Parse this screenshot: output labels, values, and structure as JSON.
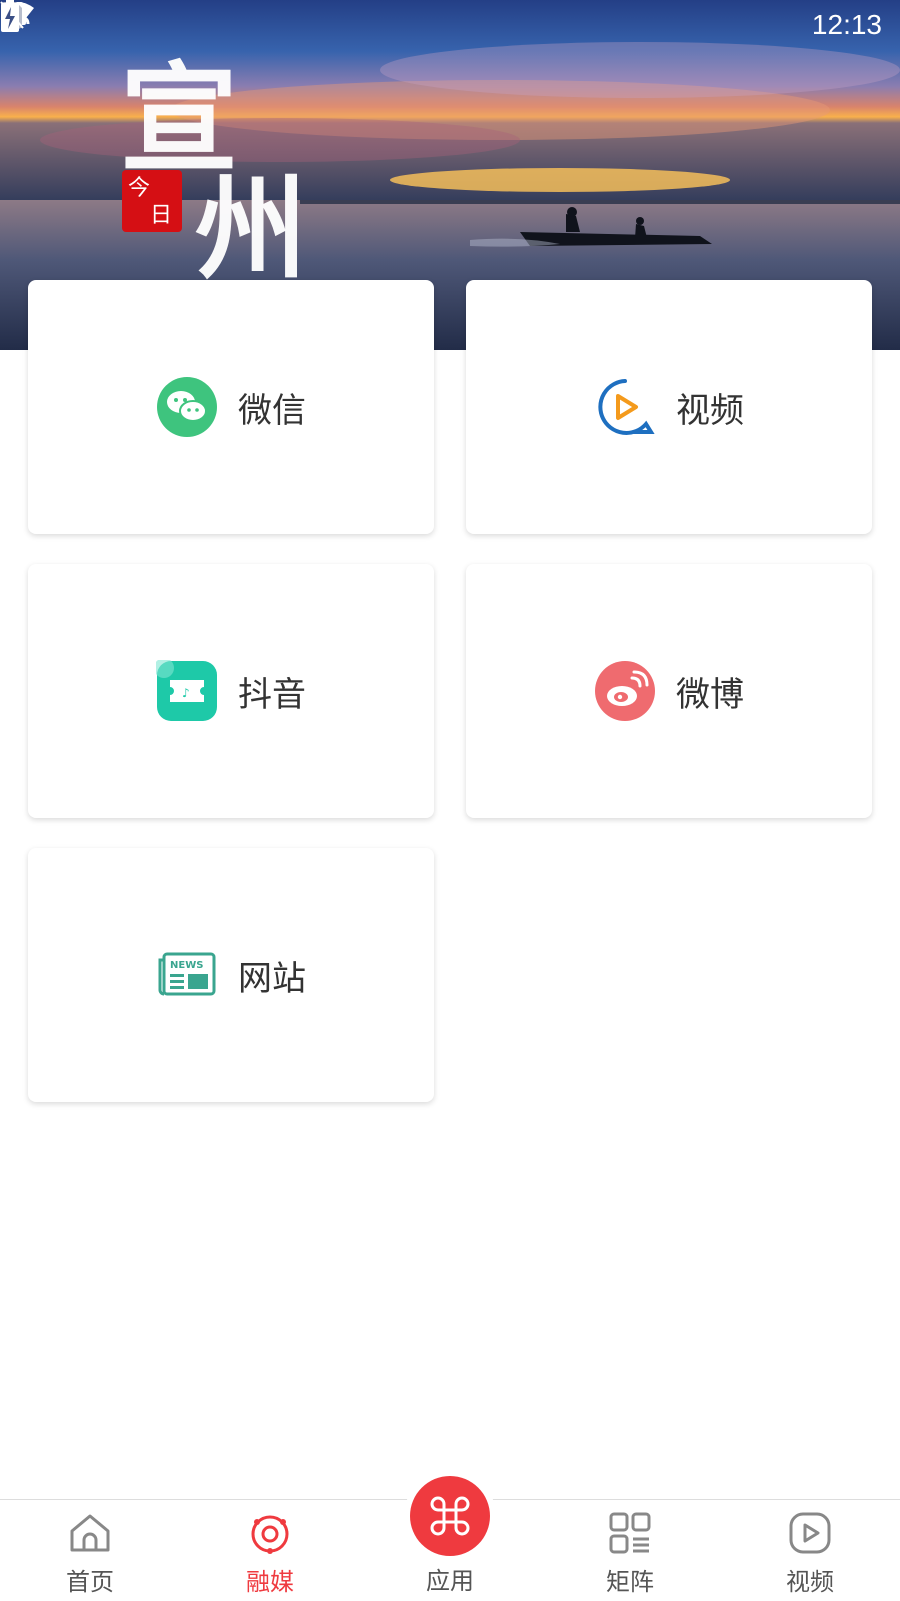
{
  "status_bar": {
    "time": "12:13",
    "icons": [
      "image-icon",
      "bug-icon",
      "text-input-icon",
      "wifi-icon",
      "no-sim-icon",
      "battery-charging-icon"
    ]
  },
  "banner": {
    "logo_text": "宣州",
    "seal_text": "今日"
  },
  "cards": [
    {
      "label": "微信",
      "icon": "wechat-icon",
      "color": "#3ec47e"
    },
    {
      "label": "视频",
      "icon": "video-play-icon",
      "color": "#1e6fc0"
    },
    {
      "label": "抖音",
      "icon": "douyin-icon",
      "color": "#1ec9a8"
    },
    {
      "label": "微博",
      "icon": "weibo-icon",
      "color": "#ef6b6f"
    },
    {
      "label": "网站",
      "icon": "news-icon",
      "color": "#3aa58f"
    }
  ],
  "bottom_nav": {
    "items": [
      {
        "label": "首页",
        "icon": "home-icon"
      },
      {
        "label": "融媒",
        "icon": "media-icon",
        "active": true
      },
      {
        "label": "应用",
        "icon": "apps-icon"
      },
      {
        "label": "矩阵",
        "icon": "matrix-icon"
      },
      {
        "label": "视频",
        "icon": "video-icon"
      }
    ],
    "active_color": "#ef3a3f"
  }
}
